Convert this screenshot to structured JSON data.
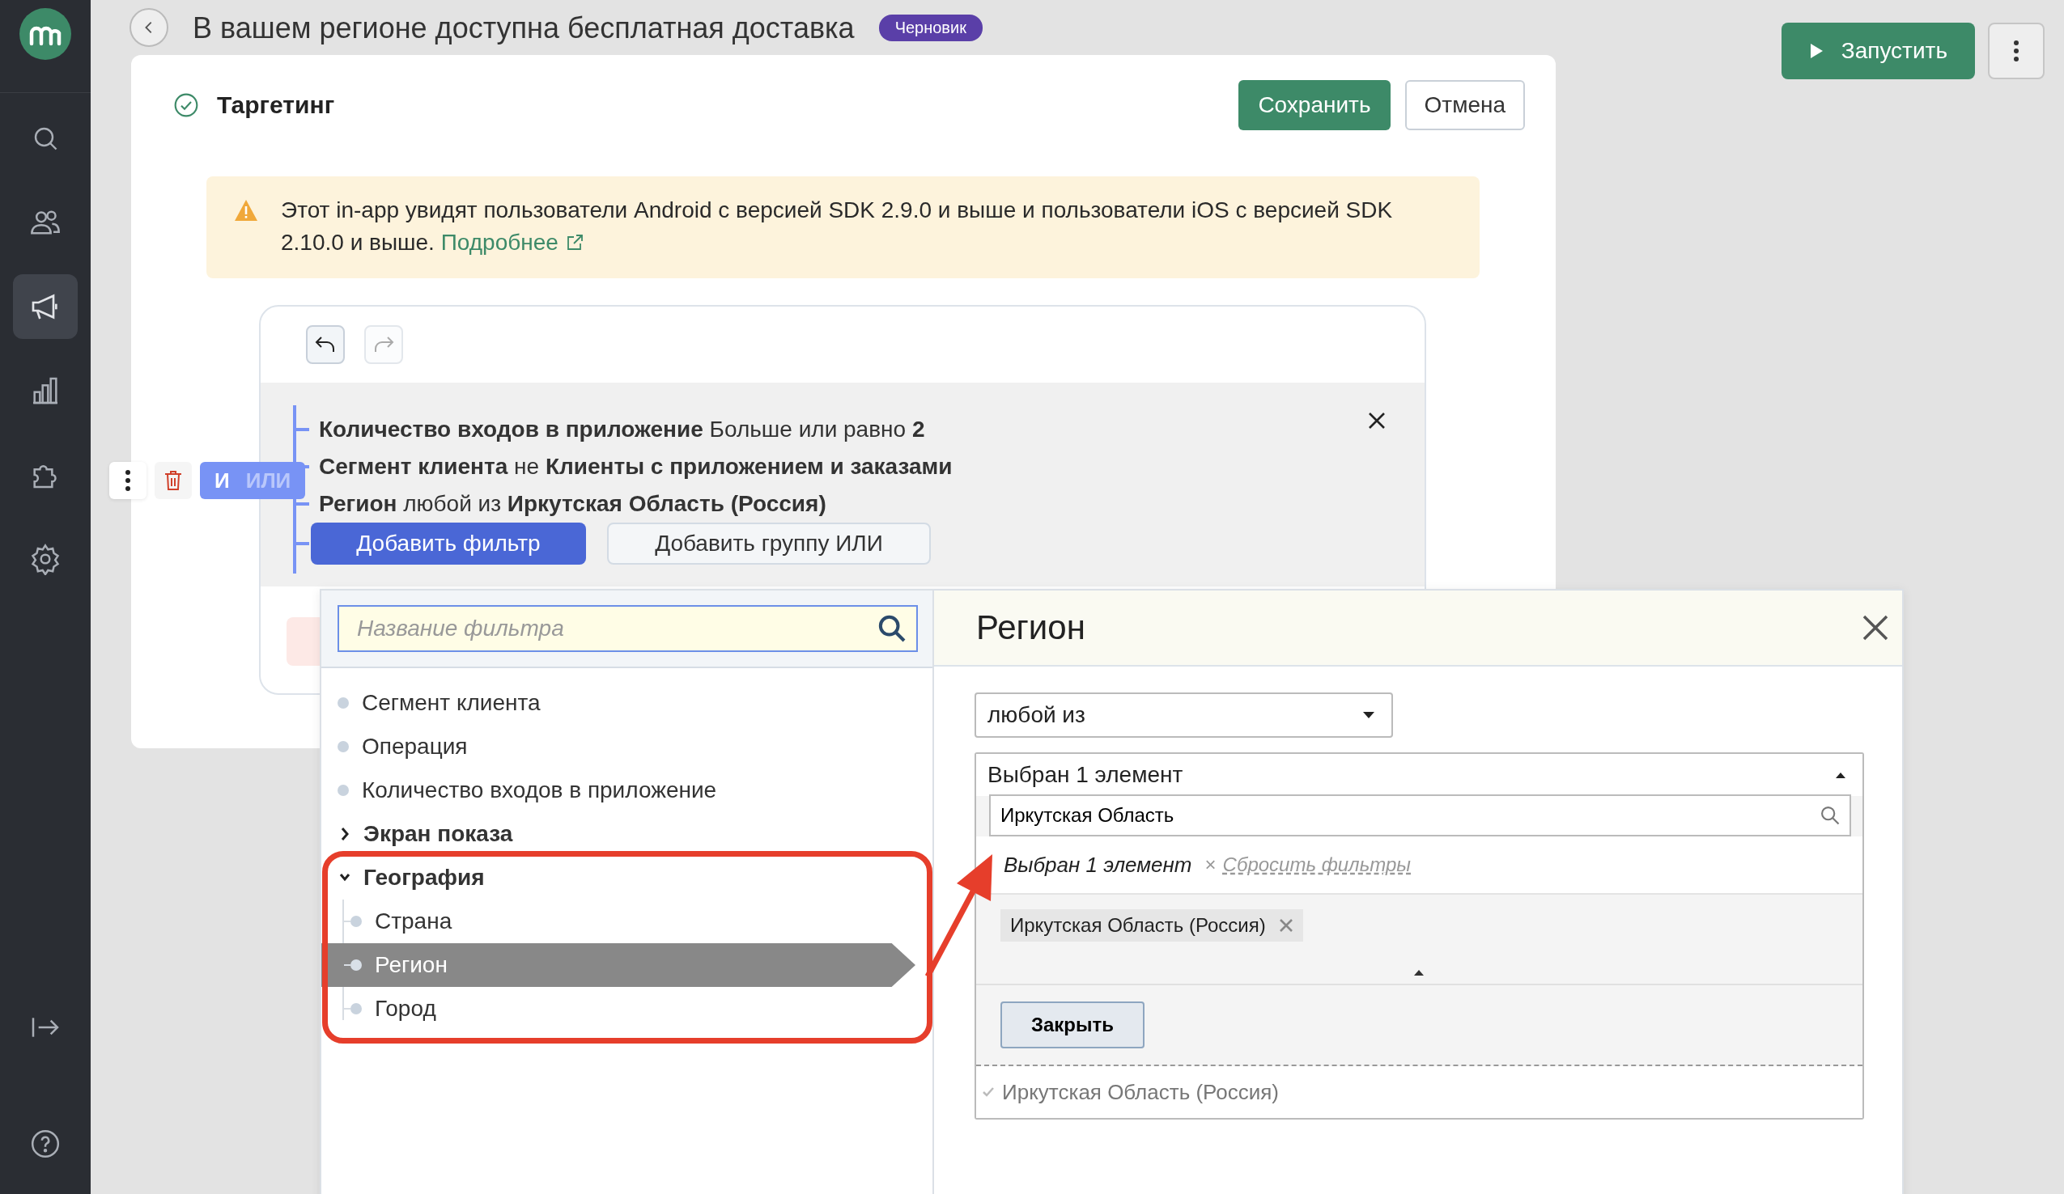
{
  "sidebar": {
    "items": [
      {
        "kind": "search",
        "selected": false
      },
      {
        "kind": "users",
        "selected": false
      },
      {
        "kind": "megaphone",
        "selected": true
      },
      {
        "kind": "chart",
        "selected": false
      },
      {
        "kind": "puzzle",
        "selected": false
      },
      {
        "kind": "gear",
        "selected": false
      },
      {
        "kind": "logout",
        "selected": false
      },
      {
        "kind": "help",
        "selected": false
      }
    ]
  },
  "page": {
    "title": "В вашем регионе доступна бесплатная доставка",
    "status_badge": "Черновик",
    "run_button": "Запустить"
  },
  "modal": {
    "title": "Таргетинг",
    "save_button": "Сохранить",
    "cancel_button": "Отмена",
    "notice": {
      "text": "Этот in-app увидят пользователи Android с версией SDK 2.9.0 и выше и пользователи iOS с версией SDK 2.10.0 и выше.",
      "link": "Подробнее"
    },
    "builder": {
      "undo_disabled": false,
      "redo_disabled": true,
      "operators": [
        {
          "label": "И",
          "selected": true
        },
        {
          "label": "ИЛИ",
          "selected": false
        }
      ],
      "conditions": [
        {
          "text": "**Количество входов в приложение** Больше или равно **2**"
        },
        {
          "text": "**Сегмент клиента** не **Клиенты с приложением и заказами**"
        },
        {
          "text": "**Регион** любой из **Иркутская Область (Россия)**"
        }
      ],
      "add_filter_button": "Добавить фильтр",
      "add_group_button": "Добавить группу ИЛИ"
    }
  },
  "filter_picker": {
    "search_placeholder": "Название фильтра",
    "items": [
      {
        "kind": "leaf",
        "label": "Сегмент клиента",
        "selected": false
      },
      {
        "kind": "leaf",
        "label": "Операция",
        "selected": false
      },
      {
        "kind": "leaf",
        "label": "Количество входов в приложение",
        "selected": false
      },
      {
        "kind": "group",
        "label": "Экран показа",
        "expanded": false
      },
      {
        "kind": "group",
        "label": "География",
        "expanded": true,
        "children": [
          {
            "kind": "leaf",
            "label": "Страна",
            "selected": false
          },
          {
            "kind": "leaf",
            "label": "Регион",
            "selected": true
          },
          {
            "kind": "leaf",
            "label": "Город",
            "selected": false
          }
        ]
      }
    ]
  },
  "region_panel": {
    "title": "Регион",
    "operator": "любой из",
    "multiselect": {
      "summary": "Выбран 1 элемент",
      "expanded": true,
      "search_value": "Иркутская Область",
      "selected_summary": "Выбран 1 элемент",
      "reset_icon": "×",
      "reset_link": "Сбросить фильтры",
      "chips": [
        "Иркутская Область (Россия)"
      ],
      "close_button": "Закрыть",
      "options": [
        {
          "label": "Иркутская Область (Россия)",
          "checked": true
        }
      ]
    }
  }
}
